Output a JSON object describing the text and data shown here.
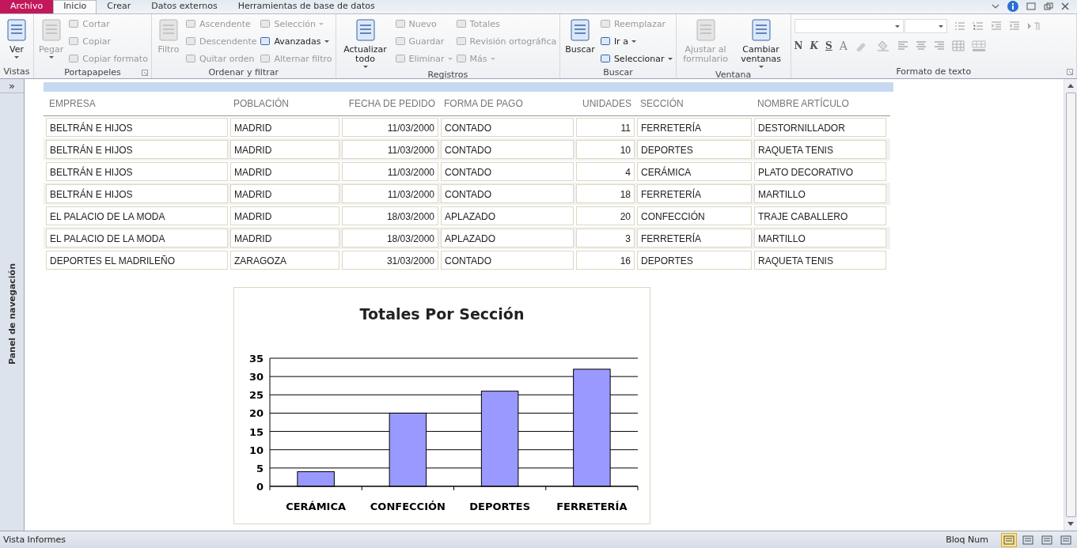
{
  "tabs": [
    {
      "label": "Archivo",
      "kind": "file",
      "selected": false
    },
    {
      "label": "Inicio",
      "kind": "tab",
      "selected": true
    },
    {
      "label": "Crear",
      "kind": "tab",
      "selected": false
    },
    {
      "label": "Datos externos",
      "kind": "tab",
      "selected": false
    },
    {
      "label": "Herramientas de base de datos",
      "kind": "tab",
      "selected": false
    }
  ],
  "ribbon": {
    "groups": [
      {
        "label": "Vistas",
        "launcher": false,
        "items": [
          {
            "kind": "large",
            "label": "Ver",
            "dropdown": true,
            "disabled": false
          }
        ]
      },
      {
        "label": "Portapapeles",
        "launcher": true,
        "items": [
          {
            "kind": "large",
            "label": "Pegar",
            "dropdown": true,
            "disabled": true
          },
          {
            "kind": "column",
            "commands": [
              {
                "label": "Cortar",
                "dropdown": false,
                "disabled": true
              },
              {
                "label": "Copiar",
                "dropdown": false,
                "disabled": true
              },
              {
                "label": "Copiar formato",
                "dropdown": false,
                "disabled": true
              }
            ]
          }
        ]
      },
      {
        "label": "Ordenar y filtrar",
        "launcher": false,
        "items": [
          {
            "kind": "large",
            "label": "Filtro",
            "dropdown": false,
            "disabled": true
          },
          {
            "kind": "column",
            "commands": [
              {
                "label": "Ascendente",
                "dropdown": false,
                "disabled": true
              },
              {
                "label": "Descendente",
                "dropdown": false,
                "disabled": true
              },
              {
                "label": "Quitar orden",
                "dropdown": false,
                "disabled": true
              }
            ]
          },
          {
            "kind": "column",
            "commands": [
              {
                "label": "Selección",
                "dropdown": true,
                "disabled": true
              },
              {
                "label": "Avanzadas",
                "dropdown": true,
                "disabled": false
              },
              {
                "label": "Alternar filtro",
                "dropdown": false,
                "disabled": true
              }
            ]
          }
        ]
      },
      {
        "label": "Registros",
        "launcher": false,
        "items": [
          {
            "kind": "large",
            "label": "Actualizar todo",
            "dropdown": true,
            "disabled": false
          },
          {
            "kind": "column",
            "commands": [
              {
                "label": "Nuevo",
                "dropdown": false,
                "disabled": true
              },
              {
                "label": "Guardar",
                "dropdown": false,
                "disabled": true
              },
              {
                "label": "Eliminar",
                "dropdown": true,
                "disabled": true
              }
            ]
          },
          {
            "kind": "column",
            "commands": [
              {
                "label": "Totales",
                "dropdown": false,
                "disabled": true
              },
              {
                "label": "Revisión ortográfica",
                "dropdown": false,
                "disabled": true
              },
              {
                "label": "Más",
                "dropdown": true,
                "disabled": true
              }
            ]
          }
        ]
      },
      {
        "label": "Buscar",
        "launcher": false,
        "items": [
          {
            "kind": "large",
            "label": "Buscar",
            "dropdown": false,
            "disabled": false
          },
          {
            "kind": "column",
            "commands": [
              {
                "label": "Reemplazar",
                "dropdown": false,
                "disabled": true
              },
              {
                "label": "Ir a",
                "dropdown": true,
                "disabled": false
              },
              {
                "label": "Seleccionar",
                "dropdown": true,
                "disabled": false
              }
            ]
          }
        ]
      },
      {
        "label": "Ventana",
        "launcher": false,
        "items": [
          {
            "kind": "large",
            "label": "Ajustar al formulario",
            "dropdown": false,
            "disabled": true
          },
          {
            "kind": "large",
            "label": "Cambiar ventanas",
            "dropdown": true,
            "disabled": false
          }
        ]
      },
      {
        "label": "Formato de texto",
        "launcher": true,
        "items": [
          {
            "kind": "format",
            "style_buttons": [
              "N",
              "K",
              "S"
            ],
            "font_color": "A"
          }
        ]
      }
    ]
  },
  "nav_pane": {
    "title": "Panel de navegación",
    "toggle": "»"
  },
  "report": {
    "columns": [
      {
        "label": "EMPRESA",
        "kind": "text"
      },
      {
        "label": "POBLACIÓN",
        "kind": "text"
      },
      {
        "label": "FECHA DE PEDIDO",
        "kind": "number"
      },
      {
        "label": "FORMA DE PAGO",
        "kind": "text"
      },
      {
        "label": "UNIDADES",
        "kind": "number"
      },
      {
        "label": "SECCIÓN",
        "kind": "text"
      },
      {
        "label": "NOMBRE ARTÍCULO",
        "kind": "text"
      }
    ],
    "rows": [
      [
        "BELTRÁN E HIJOS",
        "MADRID",
        "11/03/2000",
        "CONTADO",
        "11",
        "FERRETERÍA",
        "DESTORNILLADOR"
      ],
      [
        "BELTRÁN E HIJOS",
        "MADRID",
        "11/03/2000",
        "CONTADO",
        "10",
        "DEPORTES",
        "RAQUETA TENIS"
      ],
      [
        "BELTRÁN E HIJOS",
        "MADRID",
        "11/03/2000",
        "CONTADO",
        "4",
        "CERÁMICA",
        "PLATO DECORATIVO"
      ],
      [
        "BELTRÁN E HIJOS",
        "MADRID",
        "11/03/2000",
        "CONTADO",
        "18",
        "FERRETERÍA",
        "MARTILLO"
      ],
      [
        "EL PALACIO DE LA MODA",
        "MADRID",
        "18/03/2000",
        "APLAZADO",
        "20",
        "CONFECCIÓN",
        "TRAJE CABALLERO"
      ],
      [
        "EL PALACIO DE LA MODA",
        "MADRID",
        "18/03/2000",
        "APLAZADO",
        "3",
        "FERRETERÍA",
        "MARTILLO"
      ],
      [
        "DEPORTES EL MADRILEÑO",
        "ZARAGOZA",
        "31/03/2000",
        "CONTADO",
        "16",
        "DEPORTES",
        "RAQUETA TENIS"
      ]
    ],
    "chart_data": {
      "type": "bar",
      "title": "Totales Por Sección",
      "categories": [
        "CERÁMICA",
        "CONFECCIÓN",
        "DEPORTES",
        "FERRETERÍA"
      ],
      "series": [
        {
          "color": "#9999ff",
          "values": [
            4,
            20,
            26,
            32
          ]
        }
      ],
      "grid": true,
      "ylim": [
        0,
        35
      ],
      "yticks": [
        0,
        5,
        10,
        15,
        20,
        25,
        30,
        35
      ]
    }
  },
  "status_bar": {
    "left": "Vista Informes",
    "right": "Bloq Num",
    "views": [
      {
        "selected": true
      },
      {
        "selected": false
      },
      {
        "selected": false
      },
      {
        "selected": false
      }
    ]
  }
}
